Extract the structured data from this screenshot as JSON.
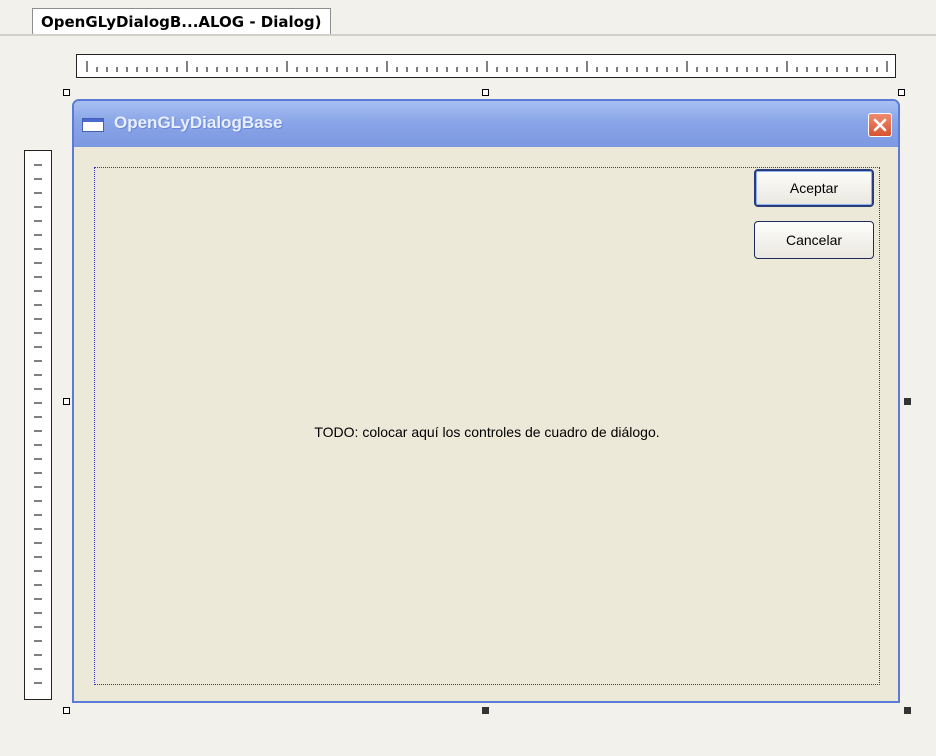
{
  "editor": {
    "tab_label": "OpenGLyDialogB...ALOG - Dialog)"
  },
  "dialog": {
    "title": "OpenGLyDialogBase",
    "placeholder": "TODO: colocar aquí los controles de cuadro de diálogo.",
    "buttons": {
      "ok": "Aceptar",
      "cancel": "Cancelar"
    }
  },
  "icons": {
    "window": "window-icon",
    "close": "close-icon"
  },
  "colors": {
    "titlebar": "#8aa5e8",
    "client": "#ece9d8",
    "close": "#d8532f"
  }
}
